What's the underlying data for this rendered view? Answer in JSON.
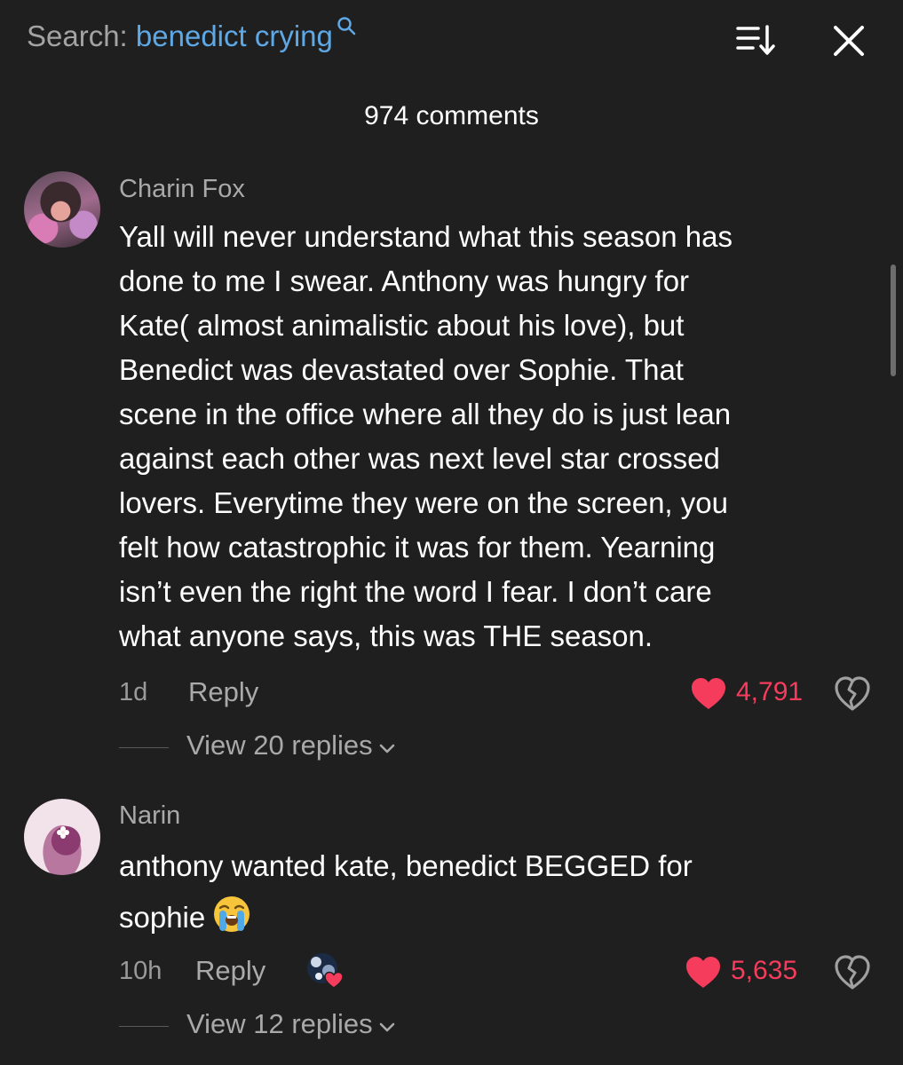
{
  "header": {
    "search_prefix": "Search: ",
    "search_term": "benedict crying",
    "search_icon": "search-icon",
    "sort_icon": "sort-icon",
    "close_icon": "close-icon"
  },
  "comment_count": "974 comments",
  "colors": {
    "background": "#1f1f1f",
    "search_term": "#5fa8e6",
    "like": "#f53c5c",
    "muted": "#a9a9a9"
  },
  "comments": [
    {
      "username": "Charin Fox",
      "lines": [
        "Yall will never understand what this season has",
        "done to me I swear. Anthony was hungry for",
        "Kate( almost animalistic about his love), but",
        "Benedict was devastated over Sophie. That",
        "scene in the office where all they do is just lean",
        "against each other was next level star crossed",
        "lovers. Everytime they were on the screen, you",
        "felt how catastrophic it was for them. Yearning",
        "isn’t even the right the word I fear. I don’t care",
        "what anyone says, this was THE season."
      ],
      "time": "1d",
      "reply_label": "Reply",
      "likes": "4,791",
      "liked": true,
      "view_replies": "View 20 replies"
    },
    {
      "username": "Narin",
      "lines": [
        "anthony wanted kate, benedict BEGGED for",
        "sophie"
      ],
      "emoji": "loudly-crying-face-emoji",
      "time": "10h",
      "reply_label": "Reply",
      "creator_liked": true,
      "likes": "5,635",
      "liked": true,
      "view_replies": "View 12 replies"
    }
  ]
}
